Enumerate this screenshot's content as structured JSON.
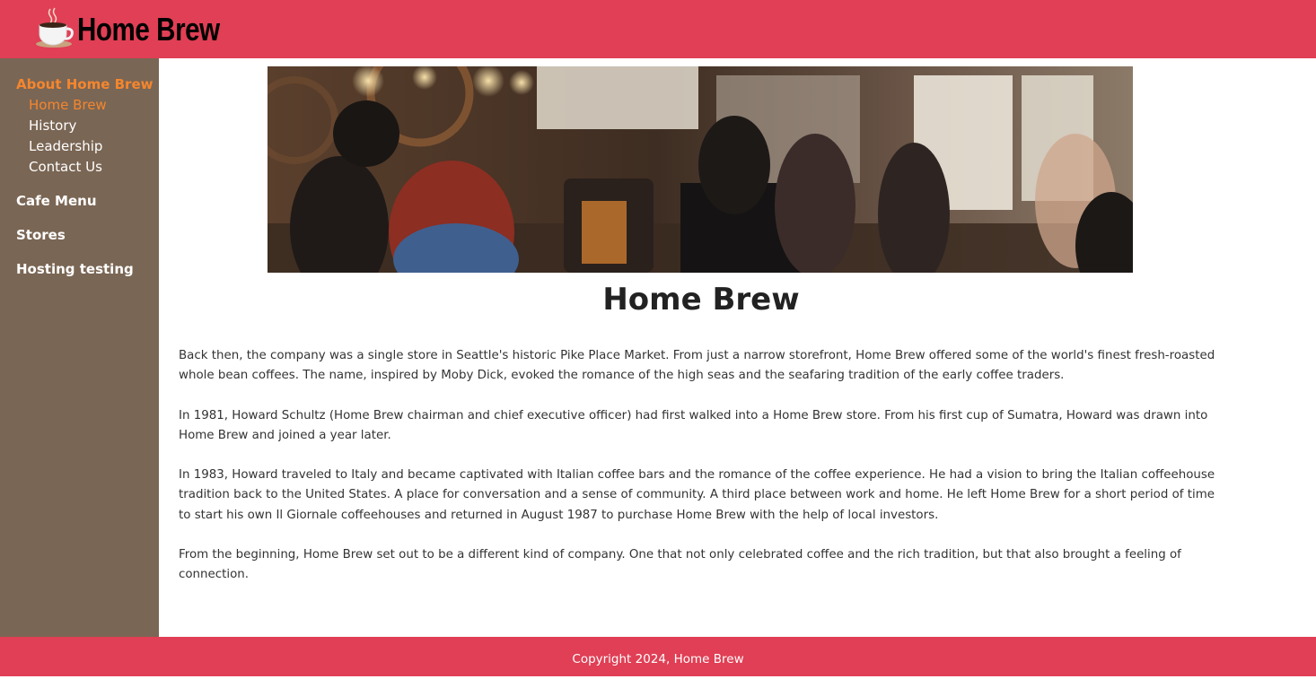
{
  "header": {
    "brand": "Home Brew"
  },
  "sidebar": {
    "sections": [
      {
        "label": "About Home Brew",
        "active": true,
        "items": [
          {
            "label": "Home Brew",
            "active": true
          },
          {
            "label": "History"
          },
          {
            "label": "Leadership"
          },
          {
            "label": "Contact Us"
          }
        ]
      },
      {
        "label": "Cafe Menu"
      },
      {
        "label": "Stores"
      },
      {
        "label": "Hosting testing"
      }
    ]
  },
  "main": {
    "title": "Home Brew",
    "paragraphs": [
      "Back then, the company was a single store in Seattle's historic Pike Place Market. From just a narrow storefront, Home Brew offered some of the world's finest fresh-roasted whole bean coffees. The name, inspired by Moby Dick, evoked the romance of the high seas and the seafaring tradition of the early coffee traders.",
      "In 1981, Howard Schultz (Home Brew chairman and chief executive officer) had first walked into a Home Brew store. From his first cup of Sumatra, Howard was drawn into Home Brew and joined a year later.",
      "In 1983, Howard traveled to Italy and became captivated with Italian coffee bars and the romance of the coffee experience. He had a vision to bring the Italian coffeehouse tradition back to the United States. A place for conversation and a sense of community. A third place between work and home. He left Home Brew for a short period of time to start his own Il Giornale coffeehouses and returned in August 1987 to purchase Home Brew with the help of local investors.",
      "From the beginning, Home Brew set out to be a different kind of company. One that not only celebrated coffee and the rich tradition, but that also brought a feeling of connection."
    ]
  },
  "footer": {
    "copyright": "Copyright 2024, Home Brew"
  },
  "icons": {
    "logo": "coffee-cup-icon"
  },
  "colors": {
    "header_bg": "#e03f55",
    "sidebar_bg": "#7a6654",
    "accent": "#f5862e",
    "footer_bg": "#e03f55"
  }
}
